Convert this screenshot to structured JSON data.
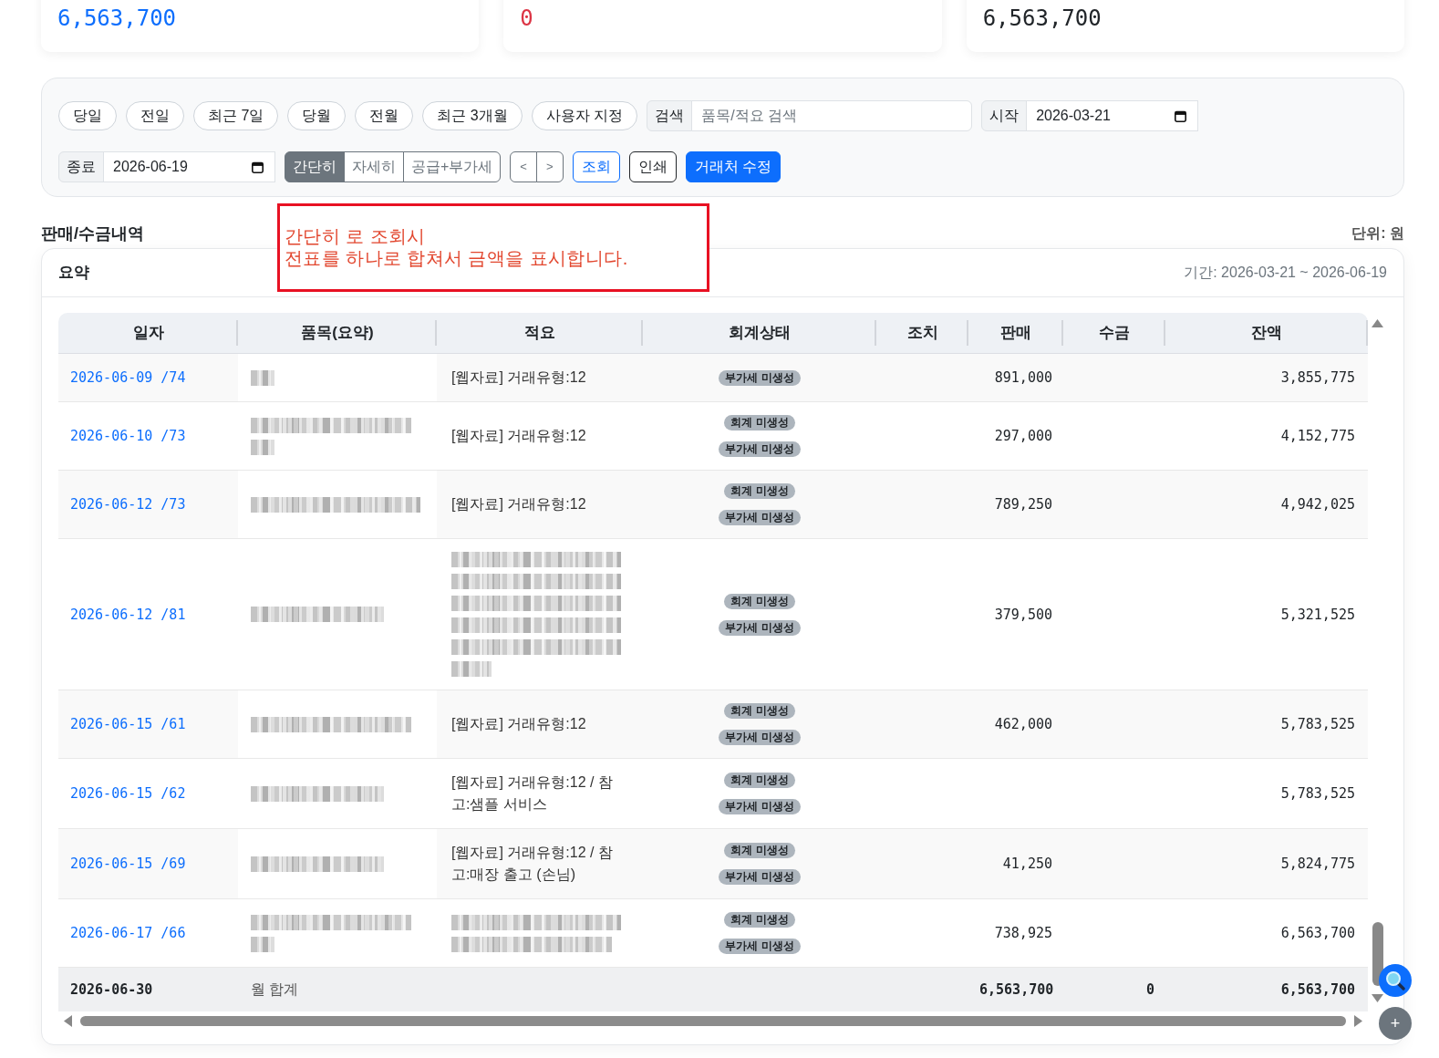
{
  "summary_cards": [
    {
      "value": "6,563,700",
      "color": "#0d6efd"
    },
    {
      "value": "0",
      "color": "#dc3545"
    },
    {
      "value": "6,563,700",
      "color": "#212529"
    }
  ],
  "filters": {
    "period_buttons": [
      {
        "label": "당일",
        "selected": false
      },
      {
        "label": "전일",
        "selected": false
      },
      {
        "label": "최근 7일",
        "selected": false
      },
      {
        "label": "당월",
        "selected": false
      },
      {
        "label": "전월",
        "selected": false
      },
      {
        "label": "최근 3개월",
        "selected": false
      },
      {
        "label": "사용자 지정",
        "selected": false
      }
    ],
    "search": {
      "label": "검색",
      "placeholder": "품목/적요 검색"
    },
    "start_date": {
      "label": "시작",
      "value": "2026-03-21"
    },
    "end_date": {
      "label": "종료",
      "value": "2026-06-19"
    },
    "view_modes": [
      {
        "label": "간단히",
        "selected": true
      },
      {
        "label": "자세히",
        "selected": false
      },
      {
        "label": "공급+부가세",
        "selected": false
      }
    ],
    "nav_buttons": [
      {
        "label": "<"
      },
      {
        "label": ">"
      }
    ],
    "actions": [
      {
        "label": "조회",
        "kind": "outlined"
      },
      {
        "label": "인쇄",
        "kind": "bordered"
      },
      {
        "label": "거래처 수정",
        "kind": "filled"
      }
    ]
  },
  "annotation": {
    "text": "간단히 로 조회시\n전표를 하나로 합쳐서 금액을 표시합니다."
  },
  "section": {
    "title": "판매/수금내역",
    "unit": "단위: 원"
  },
  "ledger": {
    "title": "요약",
    "period": "기간: 2026-03-21 ~ 2026-06-19",
    "columns": [
      "일자",
      "품목(요약)",
      "적요",
      "회계상태",
      "조치",
      "판매",
      "수금",
      "잔액"
    ],
    "rows": [
      {
        "date": "2026-06-09 /74",
        "item": {
          "kind": "blurred",
          "lines": [
            {
              "kind": "stub"
            }
          ]
        },
        "memo": {
          "kind": "text",
          "text": "[웹자료] 거래유형:12"
        },
        "badges": [
          "부가세 미생성"
        ],
        "sales": "891,000",
        "balance": "3,855,775"
      },
      {
        "date": "2026-06-10 /73",
        "item": {
          "kind": "blurred",
          "lines": [
            {
              "kind": "long"
            },
            {
              "kind": "stub"
            }
          ]
        },
        "memo": {
          "kind": "text",
          "text": "[웹자료] 거래유형:12"
        },
        "badges": [
          "회계 미생성",
          "부가세 미생성"
        ],
        "sales": "297,000",
        "balance": "4,152,775"
      },
      {
        "date": "2026-06-12 /73",
        "item": {
          "kind": "blurred",
          "lines": [
            {
              "kind": "full"
            }
          ]
        },
        "memo": {
          "kind": "text",
          "text": "[웹자료] 거래유형:12"
        },
        "badges": [
          "회계 미생성",
          "부가세 미생성"
        ],
        "sales": "789,250",
        "balance": "4,942,025"
      },
      {
        "date": "2026-06-12 /81",
        "item": {
          "kind": "blurred",
          "lines": [
            {
              "kind": "medium"
            }
          ]
        },
        "memo": {
          "kind": "blurred",
          "lines": [
            {
              "kind": "full"
            },
            {
              "kind": "full"
            },
            {
              "kind": "full"
            },
            {
              "kind": "full"
            },
            {
              "kind": "full"
            },
            {
              "kind": "tail"
            }
          ]
        },
        "badges": [
          "회계 미생성",
          "부가세 미생성"
        ],
        "sales": "379,500",
        "balance": "5,321,525"
      },
      {
        "date": "2026-06-15 /61",
        "item": {
          "kind": "blurred",
          "lines": [
            {
              "kind": "long"
            }
          ]
        },
        "memo": {
          "kind": "text",
          "text": "[웹자료] 거래유형:12"
        },
        "badges": [
          "회계 미생성",
          "부가세 미생성"
        ],
        "sales": "462,000",
        "balance": "5,783,525"
      },
      {
        "date": "2026-06-15 /62",
        "item": {
          "kind": "blurred",
          "lines": [
            {
              "kind": "medium"
            }
          ]
        },
        "memo": {
          "kind": "text",
          "text": "[웹자료] 거래유형:12 / 참고:샘플 서비스"
        },
        "badges": [
          "회계 미생성",
          "부가세 미생성"
        ],
        "balance": "5,783,525"
      },
      {
        "date": "2026-06-15 /69",
        "item": {
          "kind": "blurred",
          "lines": [
            {
              "kind": "medium"
            }
          ]
        },
        "memo": {
          "kind": "text",
          "text": "[웹자료] 거래유형:12 / 참고:매장 출고 (손님)"
        },
        "badges": [
          "회계 미생성",
          "부가세 미생성"
        ],
        "sales": "41,250",
        "balance": "5,824,775"
      },
      {
        "date": "2026-06-17 /66",
        "item": {
          "kind": "blurred",
          "lines": [
            {
              "kind": "long"
            },
            {
              "kind": "stub"
            }
          ]
        },
        "memo": {
          "kind": "blurred",
          "lines": [
            {
              "kind": "full"
            },
            {
              "kind": "long"
            }
          ]
        },
        "badges": [
          "회계 미생성",
          "부가세 미생성"
        ],
        "sales": "738,925",
        "balance": "6,563,700"
      }
    ],
    "total": {
      "date": "2026-06-30",
      "label": "월 합계",
      "sales": "6,563,700",
      "receipt": "0",
      "balance": "6,563,700"
    }
  },
  "floating_buttons": [
    {
      "kind": "search"
    },
    {
      "kind": "add",
      "label": "+"
    }
  ]
}
